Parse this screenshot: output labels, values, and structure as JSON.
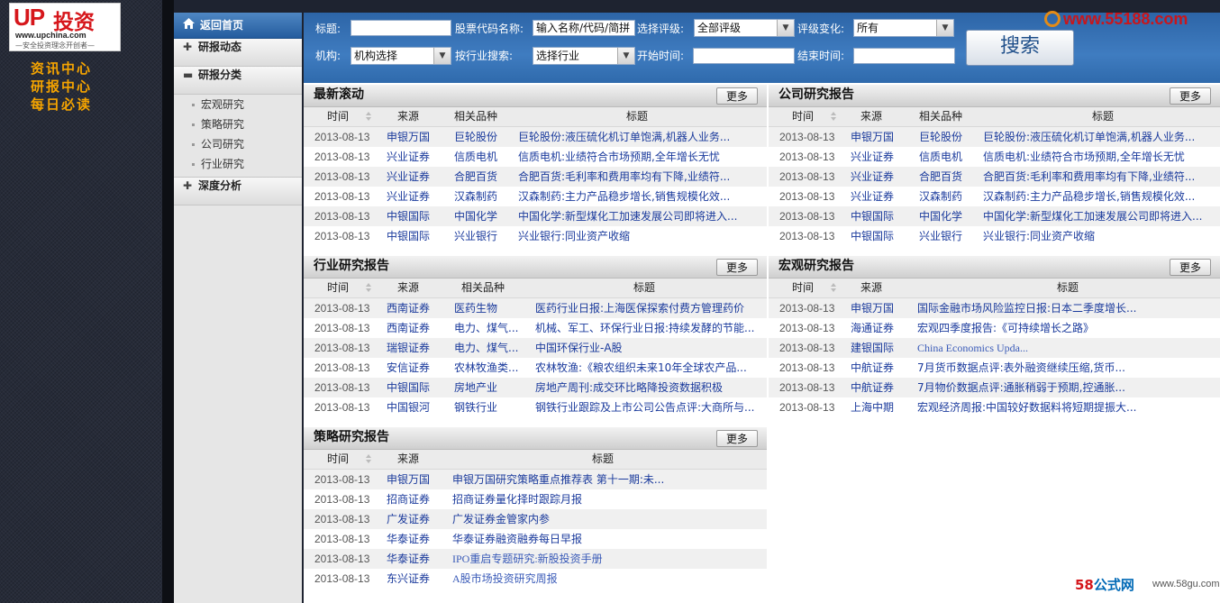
{
  "logo": {
    "up": "UP",
    "cn": "投资",
    "url": "www.upchina.com",
    "slogan": "—安全投资理念开创者—"
  },
  "left_links": [
    "资讯中心",
    "研报中心",
    "每日必读"
  ],
  "sidebar": {
    "home": "返回首页",
    "cats": [
      {
        "label": "研报动态",
        "expanded": false
      },
      {
        "label": "研报分类",
        "expanded": true,
        "subs": [
          "宏观研究",
          "策略研究",
          "公司研究",
          "行业研究"
        ]
      },
      {
        "label": "深度分析",
        "expanded": false
      }
    ]
  },
  "search": {
    "title_label": "标题:",
    "code_label": "股票代码名称:",
    "code_value": "输入名称/代码/简拼",
    "rating_label": "选择评级:",
    "rating_value": "全部评级",
    "change_label": "评级变化:",
    "change_value": "所有",
    "org_label": "机构:",
    "org_value": "机构选择",
    "industry_label": "按行业搜索:",
    "industry_value": "选择行业",
    "start_label": "开始时间:",
    "end_label": "结束时间:",
    "button": "搜索"
  },
  "watermark": "www.55188.com",
  "more_label": "更多",
  "headers": {
    "time": "时间",
    "source": "来源",
    "product": "相关品种",
    "title": "标题"
  },
  "panels": {
    "latest": {
      "title": "最新滚动",
      "rows": [
        [
          "2013-08-13",
          "申银万国",
          "巨轮股份",
          "巨轮股份:液压硫化机订单饱满,机器人业务..."
        ],
        [
          "2013-08-13",
          "兴业证券",
          "信质电机",
          "信质电机:业绩符合市场预期,全年增长无忧"
        ],
        [
          "2013-08-13",
          "兴业证券",
          "合肥百货",
          "合肥百货:毛利率和费用率均有下降,业绩符..."
        ],
        [
          "2013-08-13",
          "兴业证券",
          "汉森制药",
          "汉森制药:主力产品稳步增长,销售规模化效..."
        ],
        [
          "2013-08-13",
          "中银国际",
          "中国化学",
          "中国化学:新型煤化工加速发展公司即将进入..."
        ],
        [
          "2013-08-13",
          "中银国际",
          "兴业银行",
          "兴业银行:同业资产收缩"
        ]
      ]
    },
    "company": {
      "title": "公司研究报告",
      "rows": [
        [
          "2013-08-13",
          "申银万国",
          "巨轮股份",
          "巨轮股份:液压硫化机订单饱满,机器人业务..."
        ],
        [
          "2013-08-13",
          "兴业证券",
          "信质电机",
          "信质电机:业绩符合市场预期,全年增长无忧"
        ],
        [
          "2013-08-13",
          "兴业证券",
          "合肥百货",
          "合肥百货:毛利率和费用率均有下降,业绩符..."
        ],
        [
          "2013-08-13",
          "兴业证券",
          "汉森制药",
          "汉森制药:主力产品稳步增长,销售规模化效..."
        ],
        [
          "2013-08-13",
          "中银国际",
          "中国化学",
          "中国化学:新型煤化工加速发展公司即将进入..."
        ],
        [
          "2013-08-13",
          "中银国际",
          "兴业银行",
          "兴业银行:同业资产收缩"
        ]
      ]
    },
    "industry": {
      "title": "行业研究报告",
      "rows": [
        [
          "2013-08-13",
          "西南证券",
          "医药生物",
          "医药行业日报:上海医保探索付费方管理药价"
        ],
        [
          "2013-08-13",
          "西南证券",
          "电力、煤气...",
          "机械、军工、环保行业日报:持续发酵的节能..."
        ],
        [
          "2013-08-13",
          "瑞银证券",
          "电力、煤气...",
          "中国环保行业-A股"
        ],
        [
          "2013-08-13",
          "安信证券",
          "农林牧渔类...",
          "农林牧渔:《粮农组织未来10年全球农产品..."
        ],
        [
          "2013-08-13",
          "中银国际",
          "房地产业",
          "房地产周刊:成交环比略降投资数据积极"
        ],
        [
          "2013-08-13",
          "中国银河",
          "钢铁行业",
          "钢铁行业跟踪及上市公司公告点评:大商所与..."
        ]
      ]
    },
    "macro": {
      "title": "宏观研究报告",
      "rows": [
        [
          "2013-08-13",
          "申银万国",
          "国际金融市场风险监控日报:日本二季度增长..."
        ],
        [
          "2013-08-13",
          "海通证券",
          "宏观四季度报告:《可持续增长之路》"
        ],
        [
          "2013-08-13",
          "建银国际",
          "China Economics Upda..."
        ],
        [
          "2013-08-13",
          "中航证券",
          "7月货币数据点评:表外融资继续压缩,货币..."
        ],
        [
          "2013-08-13",
          "中航证券",
          "7月物价数据点评:通胀稍弱于预期,控通胀..."
        ],
        [
          "2013-08-13",
          "上海中期",
          "宏观经济周报:中国较好数据料将短期提振大..."
        ]
      ]
    },
    "strategy": {
      "title": "策略研究报告",
      "rows": [
        [
          "2013-08-13",
          "申银万国",
          "申银万国研究策略重点推荐表 第十一期:未..."
        ],
        [
          "2013-08-13",
          "招商证券",
          "招商证券量化择时跟踪月报"
        ],
        [
          "2013-08-13",
          "广发证券",
          "广发证券金管家内参"
        ],
        [
          "2013-08-13",
          "华泰证券",
          "华泰证券融资融券每日早报"
        ],
        [
          "2013-08-13",
          "华泰证券",
          "IPO重启专题研究:新股投资手册"
        ],
        [
          "2013-08-13",
          "东兴证券",
          "A股市场投资研究周报"
        ]
      ]
    }
  },
  "badge": {
    "brand1": "58",
    "brand2": "公式网",
    "url": "www.58gu.com"
  }
}
